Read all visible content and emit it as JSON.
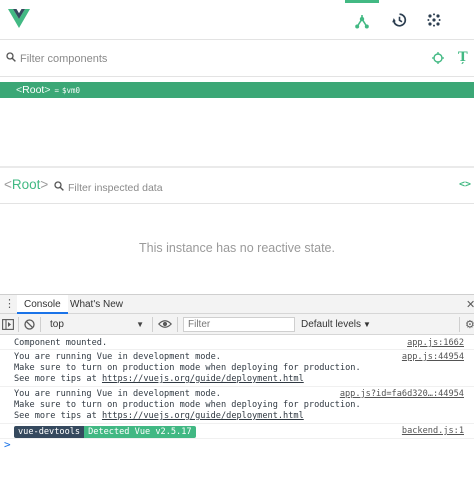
{
  "toolbar": {
    "logo": "vue-logo",
    "tabs": [
      {
        "name": "components",
        "icon": "component-tree-icon",
        "active": true
      },
      {
        "name": "vuex",
        "icon": "history-icon",
        "active": false
      },
      {
        "name": "events",
        "icon": "events-icon",
        "active": false
      }
    ]
  },
  "components_panel": {
    "filter_placeholder": "Filter components",
    "format_icon_label": "Ț",
    "tree": [
      {
        "open": "<",
        "name": "Root",
        "close": ">",
        "eq": "=",
        "vm": "$vm0",
        "selected": true
      }
    ]
  },
  "inspector": {
    "title_open": "<",
    "title_name": "Root",
    "title_close": ">",
    "filter_placeholder": "Filter inspected data",
    "code_icon_label": "<>",
    "empty_message": "This instance has no reactive state."
  },
  "drawer": {
    "tabs": [
      {
        "label": "Console",
        "active": true
      },
      {
        "label": "What's New",
        "active": false
      }
    ]
  },
  "console_toolbar": {
    "context": "top",
    "filter_placeholder": "Filter",
    "levels": "Default levels"
  },
  "console": {
    "messages": [
      {
        "lines": [
          "Component mounted."
        ],
        "link": "",
        "source": "app.js:1662"
      },
      {
        "lines": [
          "You are running Vue in development mode.",
          "Make sure to turn on production mode when deploying for production.",
          "See more tips at "
        ],
        "link": "https://vuejs.org/guide/deployment.html",
        "source": "app.js:44954"
      },
      {
        "lines": [
          "You are running Vue in development mode.",
          "Make sure to turn on production mode when deploying for production.",
          "See more tips at "
        ],
        "link": "https://vuejs.org/guide/deployment.html",
        "source": "app.js?id=fa6d320…:44954"
      },
      {
        "badge_left": "vue-devtools",
        "badge_right": "Detected Vue v2.5.17",
        "source": "backend.js:1"
      }
    ],
    "prompt": ">"
  },
  "colors": {
    "accent": "#42b983",
    "selected_row": "#3ba776",
    "devtools_badge": "#35495e"
  }
}
